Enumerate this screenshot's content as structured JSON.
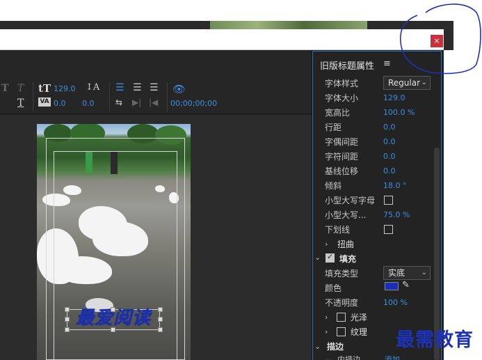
{
  "window": {
    "close_glyph": "×"
  },
  "toolbar": {
    "font_size_value": "129.0",
    "tracking_value": "0.0",
    "leading_value": "0.0",
    "timecode": "00;00;00;00"
  },
  "canvas": {
    "title_text": "最爱阅读"
  },
  "panel": {
    "title": "旧版标题属性",
    "menu_glyph": "≡",
    "rows": [
      {
        "label": "字体样式",
        "value": "Regular"
      },
      {
        "label": "字体大小",
        "value": "129.0"
      },
      {
        "label": "宽高比",
        "value": "100.0 %"
      },
      {
        "label": "行距",
        "value": "0.0"
      },
      {
        "label": "字偶间距",
        "value": "0.0"
      },
      {
        "label": "字符间距",
        "value": "0.0"
      },
      {
        "label": "基线位移",
        "value": "0.0"
      },
      {
        "label": "倾斜",
        "value": "18.0 °"
      },
      {
        "label": "小型大写字母",
        "value": ""
      },
      {
        "label": "小型大写...",
        "value": "75.0 %"
      },
      {
        "label": "下划线",
        "value": ""
      }
    ],
    "distort_label": "扭曲",
    "fill_label": "填充",
    "fill_type_label": "填充类型",
    "fill_type_value": "实底",
    "color_label": "颜色",
    "opacity_label": "不透明度",
    "opacity_value": "100 %",
    "gloss_label": "光泽",
    "texture_label": "纹理",
    "stroke_label": "描边",
    "inner_stroke_label": "内描边",
    "add_link": "添加",
    "fill_color": "#1a2fb5"
  },
  "watermark": "最需教育",
  "colors": {
    "accent": "#3d8fe0",
    "close": "#c8323c",
    "annotation": "#1c32b8"
  }
}
